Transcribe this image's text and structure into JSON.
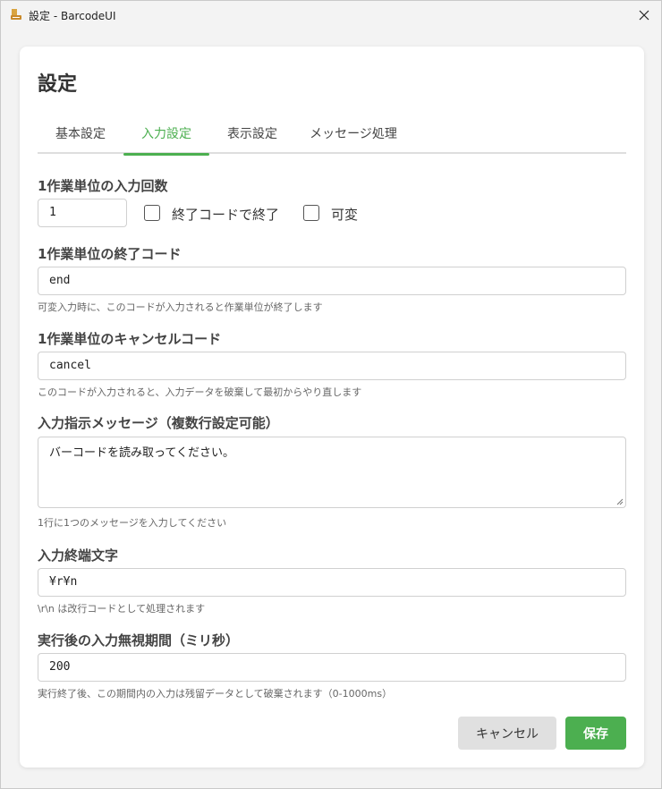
{
  "window": {
    "title": "設定 - BarcodeUI"
  },
  "page": {
    "title": "設定"
  },
  "tabs": [
    {
      "label": "基本設定",
      "active": false
    },
    {
      "label": "入力設定",
      "active": true
    },
    {
      "label": "表示設定",
      "active": false
    },
    {
      "label": "メッセージ処理",
      "active": false
    }
  ],
  "fields": {
    "input_count": {
      "label": "1作業単位の入力回数",
      "value": "1",
      "end_code_checkbox": {
        "label": "終了コードで終了",
        "checked": false
      },
      "variable_checkbox": {
        "label": "可変",
        "checked": false
      }
    },
    "end_code": {
      "label": "1作業単位の終了コード",
      "value": "end",
      "hint": "可変入力時に、このコードが入力されると作業単位が終了します"
    },
    "cancel_code": {
      "label": "1作業単位のキャンセルコード",
      "value": "cancel",
      "hint": "このコードが入力されると、入力データを破棄して最初からやり直します"
    },
    "prompt_message": {
      "label": "入力指示メッセージ（複数行設定可能）",
      "value": "バーコードを読み取ってください。",
      "hint": "1行に1つのメッセージを入力してください"
    },
    "terminator": {
      "label": "入力終端文字",
      "value": "¥r¥n",
      "hint": "\\r\\n は改行コードとして処理されます"
    },
    "ignore_period": {
      "label": "実行後の入力無視期間（ミリ秒）",
      "value": "200",
      "hint": "実行終了後、この期間内の入力は残留データとして破棄されます（0-1000ms）"
    }
  },
  "buttons": {
    "cancel": "キャンセル",
    "save": "保存"
  },
  "colors": {
    "accent": "#4caf50",
    "cancel_bg": "#e0e0e0"
  }
}
